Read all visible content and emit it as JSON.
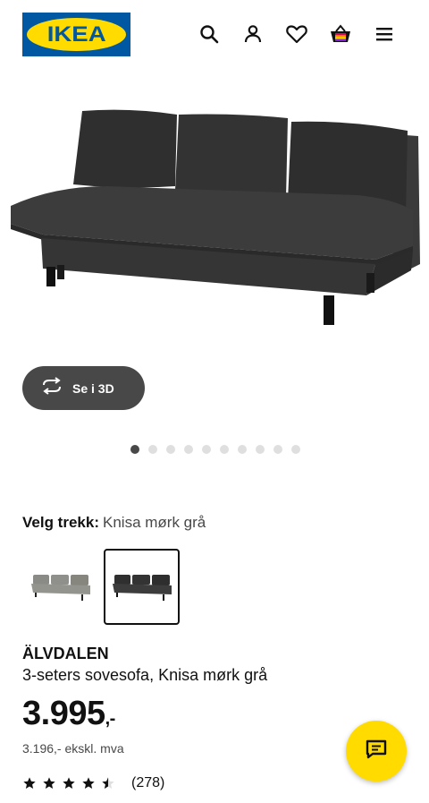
{
  "header": {
    "logo_text": "IKEA",
    "icons": [
      "search-icon",
      "user-icon",
      "heart-icon",
      "basket-icon",
      "menu-icon"
    ]
  },
  "gallery": {
    "view_3d_label": "Se i 3D",
    "slide_count": 10,
    "active_slide": 1
  },
  "cover": {
    "label": "Velg trekk:",
    "value": "Knisa mørk grå",
    "options": [
      "Knisa lys grå",
      "Knisa mørk grå"
    ],
    "selected_index": 1
  },
  "product": {
    "name": "ÄLVDALEN",
    "description": "3-seters sovesofa, Knisa mørk grå",
    "price": "3.995",
    "price_suffix": ",-",
    "price_ex_vat": "3.196,- ekskl. mva",
    "rating_stars": 4.5,
    "review_count": "(278)"
  },
  "colors": {
    "brand_blue": "#0058a3",
    "brand_yellow": "#ffdb00",
    "button_dark": "#484848"
  }
}
